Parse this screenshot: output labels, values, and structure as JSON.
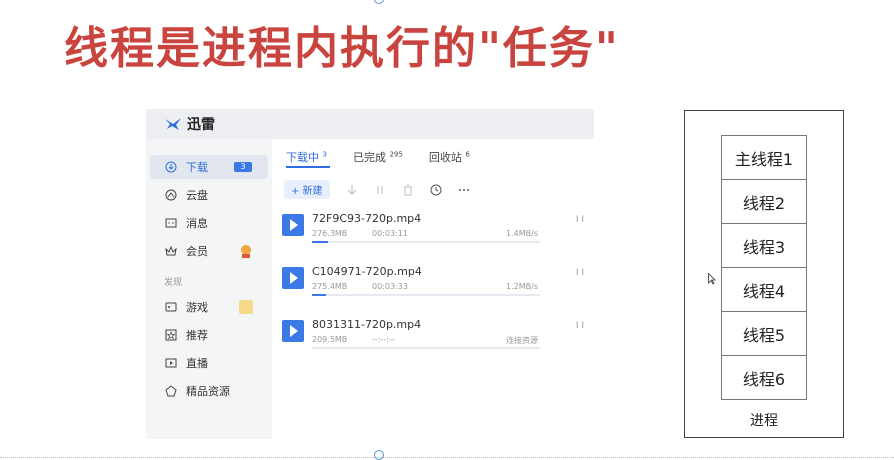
{
  "slide": {
    "title": "线程是进程内执行的\"任务\""
  },
  "app": {
    "name": "迅雷",
    "sidebar": {
      "items": [
        {
          "label": "下载",
          "icon": "download-icon",
          "badge": "3",
          "active": true
        },
        {
          "label": "云盘",
          "icon": "cloud-icon"
        },
        {
          "label": "消息",
          "icon": "message-icon"
        },
        {
          "label": "会员",
          "icon": "vip-icon"
        }
      ],
      "section_label": "发现",
      "discover_items": [
        {
          "label": "游戏",
          "icon": "game-icon"
        },
        {
          "label": "推荐",
          "icon": "recommend-icon"
        },
        {
          "label": "直播",
          "icon": "live-icon"
        },
        {
          "label": "精品资源",
          "icon": "resource-icon"
        }
      ]
    },
    "tabs": [
      {
        "label": "下载中",
        "count": "3"
      },
      {
        "label": "已完成",
        "count": "295"
      },
      {
        "label": "回收站",
        "count": "6"
      }
    ],
    "toolbar": {
      "new_label": "+ 新建",
      "icons": [
        "arrow-down-icon",
        "pause-icon",
        "trash-icon",
        "clock-icon",
        "more-icon"
      ]
    },
    "downloads": [
      {
        "name": "72F9C93-720p.mp4",
        "size": "276.3MB",
        "time": "00:03:11",
        "speed": "1.4MB/s",
        "progress": 0.07
      },
      {
        "name": "C104971-720p.mp4",
        "size": "275.4MB",
        "time": "00:03:33",
        "speed": "1.2MB/s",
        "progress": 0.06
      },
      {
        "name": "8031311-720p.mp4",
        "size": "209.5MB",
        "time": "--:--:--",
        "speed": "连接资源",
        "progress": 0.0
      }
    ],
    "pause_glyph": "I I"
  },
  "diagram": {
    "threads": [
      "主线程1",
      "线程2",
      "线程3",
      "线程4",
      "线程5",
      "线程6"
    ],
    "process_label": "进程"
  },
  "colors": {
    "title": "#c9443e",
    "accent": "#3b7ae6"
  }
}
